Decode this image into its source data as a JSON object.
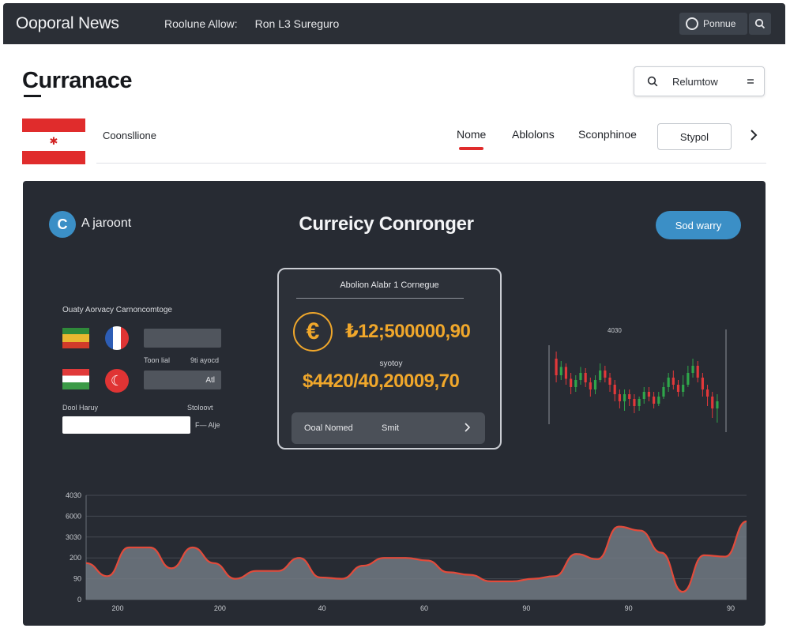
{
  "topbar": {
    "brand": "Ooporal News",
    "nav": [
      "Roolune Allow:",
      "Ron L3 Sureguro"
    ],
    "search_label": "Ponnue",
    "search_icon": "search-icon"
  },
  "header": {
    "title": "Curranace",
    "search_placeholder": "Relumtow",
    "menu_icon": "menu-icon"
  },
  "subnav": {
    "label": "Coonsllione",
    "tabs": [
      {
        "label": "Nome",
        "active": true
      },
      {
        "label": "Ablolons",
        "active": false
      },
      {
        "label": "Sconphinoe",
        "active": false
      }
    ],
    "button": "Stypol",
    "flag_emblem": "✱"
  },
  "panel": {
    "account_logo": "C",
    "account_name": "A jaroont",
    "title": "Curreicy Conronger",
    "primary_button": "Sod warry",
    "converter": {
      "caption": "Ouaty Aorvacy Carnoncomtoge",
      "label_from": "Toon lial",
      "label_to": "9ti ayocd",
      "field_two_value": "Atl",
      "amount_label": "Dool Haruy",
      "amount_note": "Stoloovt",
      "amount_suffix": "F— Alje",
      "turkish_symbol": "☾"
    },
    "card": {
      "heading": "Abolion Alabr 1  Cornegue",
      "currency_symbol": "€",
      "rate": "₺12;500000,90",
      "mid_label": "syotoy",
      "result": "$4420/40,20009,70",
      "button_left": "Ooal Nomed",
      "button_right": "Smit"
    },
    "candle_chart": {
      "label": "4030"
    }
  },
  "chart_data": [
    {
      "type": "line",
      "x_ticks": [
        "200",
        "200",
        "40",
        "60",
        "90",
        "90",
        "90"
      ],
      "y_ticks": [
        "4030",
        "6000",
        "3030",
        "200",
        "90",
        "0"
      ],
      "series": [
        {
          "values": [
            280,
            180,
            400,
            400,
            240,
            400,
            280,
            160,
            220,
            220,
            320,
            170,
            160,
            260,
            320,
            320,
            300,
            210,
            190,
            140,
            140,
            160,
            180,
            350,
            310,
            560,
            530,
            360,
            60,
            340,
            330,
            600
          ]
        }
      ],
      "ylim": [
        0,
        800
      ],
      "colors": {
        "line": "#e24b3b",
        "fill": "#717983"
      }
    },
    {
      "type": "bar",
      "candles": [
        {
          "o": 62,
          "c": 48,
          "h": 68,
          "l": 42
        },
        {
          "o": 48,
          "c": 55,
          "h": 60,
          "l": 44
        },
        {
          "o": 55,
          "c": 45,
          "h": 58,
          "l": 40
        },
        {
          "o": 45,
          "c": 38,
          "h": 50,
          "l": 32
        },
        {
          "o": 38,
          "c": 44,
          "h": 48,
          "l": 34
        },
        {
          "o": 44,
          "c": 50,
          "h": 55,
          "l": 40
        },
        {
          "o": 50,
          "c": 42,
          "h": 54,
          "l": 38
        },
        {
          "o": 42,
          "c": 36,
          "h": 46,
          "l": 30
        },
        {
          "o": 36,
          "c": 44,
          "h": 48,
          "l": 32
        },
        {
          "o": 44,
          "c": 52,
          "h": 58,
          "l": 42
        },
        {
          "o": 52,
          "c": 46,
          "h": 56,
          "l": 42
        },
        {
          "o": 46,
          "c": 40,
          "h": 50,
          "l": 34
        },
        {
          "o": 40,
          "c": 32,
          "h": 44,
          "l": 26
        },
        {
          "o": 32,
          "c": 26,
          "h": 36,
          "l": 20
        },
        {
          "o": 26,
          "c": 32,
          "h": 36,
          "l": 18
        },
        {
          "o": 32,
          "c": 28,
          "h": 36,
          "l": 22
        },
        {
          "o": 28,
          "c": 22,
          "h": 32,
          "l": 16
        },
        {
          "o": 22,
          "c": 28,
          "h": 30,
          "l": 18
        },
        {
          "o": 28,
          "c": 34,
          "h": 38,
          "l": 24
        },
        {
          "o": 34,
          "c": 30,
          "h": 38,
          "l": 26
        },
        {
          "o": 30,
          "c": 24,
          "h": 34,
          "l": 20
        },
        {
          "o": 24,
          "c": 30,
          "h": 34,
          "l": 22
        },
        {
          "o": 30,
          "c": 38,
          "h": 42,
          "l": 28
        },
        {
          "o": 38,
          "c": 46,
          "h": 50,
          "l": 34
        },
        {
          "o": 46,
          "c": 40,
          "h": 52,
          "l": 36
        },
        {
          "o": 40,
          "c": 34,
          "h": 44,
          "l": 30
        },
        {
          "o": 34,
          "c": 40,
          "h": 48,
          "l": 30
        },
        {
          "o": 40,
          "c": 50,
          "h": 56,
          "l": 38
        },
        {
          "o": 50,
          "c": 56,
          "h": 62,
          "l": 46
        },
        {
          "o": 56,
          "c": 46,
          "h": 60,
          "l": 42
        },
        {
          "o": 46,
          "c": 36,
          "h": 50,
          "l": 30
        },
        {
          "o": 36,
          "c": 30,
          "h": 40,
          "l": 22
        },
        {
          "o": 30,
          "c": 20,
          "h": 34,
          "l": 12
        },
        {
          "o": 20,
          "c": 26,
          "h": 32,
          "l": 8
        }
      ],
      "ylim": [
        0,
        80
      ],
      "colors": {
        "up": "#2fa64a",
        "down": "#e2383a"
      }
    }
  ]
}
